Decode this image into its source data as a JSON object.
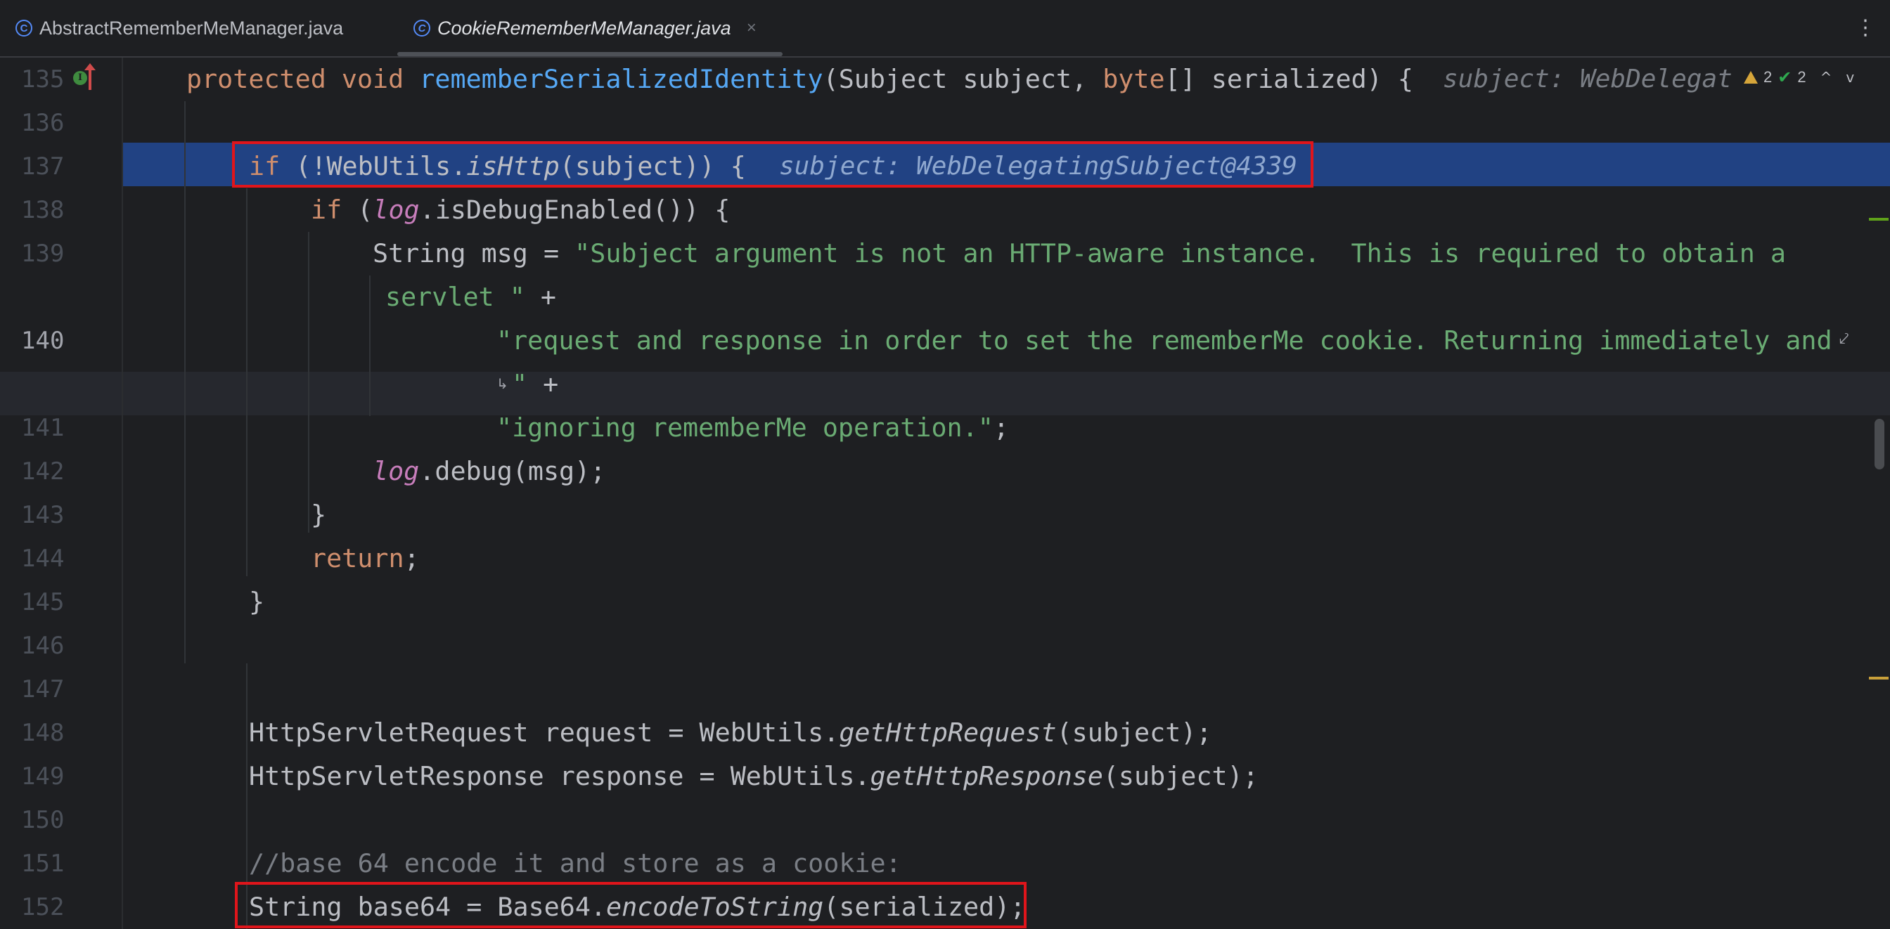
{
  "tabs": [
    {
      "label": "AbstractRememberMeManager.java",
      "icon": "java-class-icon",
      "active": false
    },
    {
      "label": "CookieRememberMeManager.java",
      "icon": "java-class-icon",
      "active": true,
      "close_icon": "close-icon"
    }
  ],
  "tab_icon_glyph": "C",
  "more_menu_glyph": "⋮",
  "close_glyph": "×",
  "inspections": {
    "warnings": "2",
    "weak_warnings": "2",
    "up_glyph": "^",
    "down_glyph": "v"
  },
  "colors": {
    "background": "#1e1f22",
    "selection": "#214283",
    "keyword": "#cf8e6d",
    "method_decl": "#56a8f5",
    "string": "#6aab73",
    "static_field": "#c77dbb",
    "comment": "#7a7e85",
    "annotation_box": "#e0151b"
  },
  "lines": {
    "l135": {
      "num": "135",
      "kw1": "protected void ",
      "fn": "rememberSerializedIdentity",
      "p1": "(Subject subject, ",
      "kw2": "byte",
      "p2": "[] serialized) {",
      "hint": "subject: WebDelegat"
    },
    "l136": {
      "num": "136"
    },
    "l137": {
      "num": "137",
      "kw": "if",
      "p1": " (!WebUtils.",
      "it": "isHttp",
      "p2": "(subject)) {",
      "hint": "subject: WebDelegatingSubject@4339"
    },
    "l138": {
      "num": "138",
      "kw": "if",
      "p1": " (",
      "st": "log",
      "p2": ".isDebugEnabled()) {"
    },
    "l139": {
      "num": "139",
      "p1": "String msg = ",
      "s": "\"Subject argument is not an HTTP-aware instance.  This is required to obtain a",
      "s_wrap": "servlet \"",
      "p_wrap": " +"
    },
    "l140": {
      "num": "140",
      "s": "\"request and response in order to set the rememberMe cookie. Returning immediately and",
      "s_wrap": "\"",
      "p_wrap": " +"
    },
    "l141": {
      "num": "141",
      "s": "\"ignoring rememberMe operation.\"",
      "p": ";"
    },
    "l142": {
      "num": "142",
      "st": "log",
      "p": ".debug(msg);"
    },
    "l143": {
      "num": "143",
      "p": "}"
    },
    "l144": {
      "num": "144",
      "kw": "return",
      "p": ";"
    },
    "l145": {
      "num": "145",
      "p": "}"
    },
    "l146": {
      "num": "146"
    },
    "l147": {
      "num": "147"
    },
    "l148": {
      "num": "148",
      "p1": "HttpServletRequest request = WebUtils.",
      "it": "getHttpRequest",
      "p2": "(subject);"
    },
    "l149": {
      "num": "149",
      "p1": "HttpServletResponse response = WebUtils.",
      "it": "getHttpResponse",
      "p2": "(subject);"
    },
    "l150": {
      "num": "150"
    },
    "l151": {
      "num": "151",
      "cm": "//base 64 encode it and store as a cookie:"
    },
    "l152": {
      "num": "152",
      "p1": "String base64 = Base64.",
      "it": "encodeToString",
      "p2": "(serialized);"
    }
  }
}
